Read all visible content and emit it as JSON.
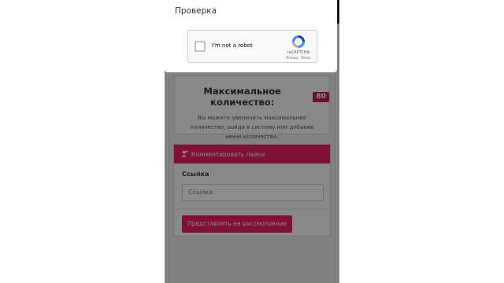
{
  "modal": {
    "title": "Проверка",
    "recaptcha": {
      "checkbox_label": "I'm not a robot",
      "brand": "reCAPTCHA",
      "privacy": "Privacy",
      "separator": "-",
      "terms": "Terms"
    }
  },
  "limit": {
    "title": "Максимальное количество:",
    "value": "80",
    "description": "Вы можете увеличить максимальное количество, войдя в систему или добавив меню количества."
  },
  "comment_form": {
    "header": "Комментировать лайки",
    "link_label": "Ссылка",
    "link_placeholder": "Ссылка",
    "submit_label": "Представлять на рассмотрение"
  },
  "colors": {
    "accent": "#e91e63",
    "badge": "#c2185b",
    "topbar": "#1f2f3d"
  }
}
